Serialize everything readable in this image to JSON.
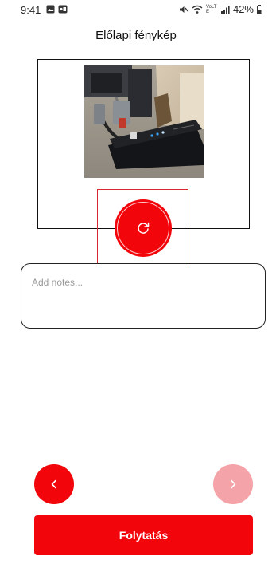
{
  "status_bar": {
    "time": "9:41",
    "network_label": "VoLTE",
    "battery": "42%",
    "icons": [
      "gallery-icon",
      "notification-icon",
      "mute-icon",
      "wifi-icon",
      "signal-icon",
      "battery-icon"
    ]
  },
  "header": {
    "title": "Előlapi fénykép"
  },
  "photo": {
    "description_icon": "device-photo"
  },
  "retake": {
    "icon": "refresh-icon"
  },
  "notes": {
    "placeholder": "Add notes...",
    "value": ""
  },
  "navigation": {
    "prev_icon": "chevron-left-icon",
    "next_icon": "chevron-right-icon"
  },
  "continue": {
    "label": "Folytatás"
  },
  "colors": {
    "accent": "#f2050b",
    "accent_disabled": "#f4a3a8",
    "highlight": "#d9272e"
  }
}
